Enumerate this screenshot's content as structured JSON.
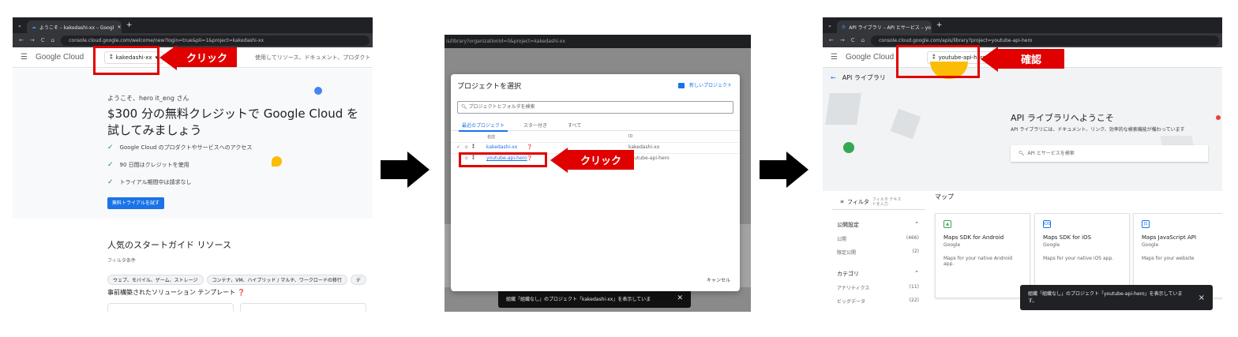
{
  "panel1": {
    "tab_title": "ようこそ – kakedashi-xx – Googl",
    "tab_close": "×",
    "tab_new": "+",
    "url": "console.cloud.google.com/welcome/new?login=true&pli=1&project=kakedashi-xx",
    "nav_icons": [
      "←",
      "→",
      "C",
      "⌂"
    ],
    "logo_google": "Google",
    "logo_cloud": " Cloud",
    "project_name": "kakedashi-xx",
    "search_placeholder": "使用してリソース、ドキュメント、プロダクト",
    "welcome_greeting": "ようこそ、hero it_eng さん",
    "headline": "$300 分の無料クレジットで Google Cloud を試してみましょう",
    "checklist": [
      "Google Cloud のプロダクトやサービスへのアクセス",
      "90 日間はクレジットを使用",
      "トライアル期間中は請求なし"
    ],
    "trial_button": "無料トライアルを試す",
    "resources_title": "人気のスタートガイド リソース",
    "filter_label": "フィルタ条件",
    "filter_chips": [
      "ウェブ、モバイル、ゲーム、ストレージ",
      "コンテナ、VM、ハイブリッド / マルチ、ワークロードの移行",
      "デ"
    ],
    "solutions_title": "事前構築されたソリューション テンプレート",
    "callout": "クリック"
  },
  "panel2": {
    "url": "is/library?organizationId=0&project=kakedashi-xx",
    "dialog_title": "プロジェクトを選択",
    "new_project": "新しいプロジェクト",
    "search_placeholder": "プロジェクトとフォルダを検索",
    "tabs": [
      "最近のプロジェクト",
      "スター付き",
      "すべて"
    ],
    "col_name": "名前",
    "col_id": "ID",
    "rows": [
      {
        "name": "kakedashi-xx",
        "id": "kakedashi-xx",
        "current": "✓"
      },
      {
        "name": "youtube-api-hero",
        "id": "youtube-api-hero",
        "current": ""
      }
    ],
    "cancel": "キャンセル",
    "toast": "組織「組織なし」のプロジェクト「kakedashi-xx」を表示していま",
    "callout": "クリック"
  },
  "panel3": {
    "tab_title": "API ライブラリ – API とサービス – yo",
    "tab_close": "×",
    "tab_new": "+",
    "url": "console.cloud.google.com/apis/library?project=youtube-api-hero",
    "nav_icons": [
      "←",
      "→",
      "C",
      "⌂"
    ],
    "logo_google": "Google",
    "logo_cloud": " Cloud",
    "project_name": "youtube-api-hero",
    "page_title": "API ライブラリ",
    "hero_title": "API ライブラリへようこそ",
    "hero_sub": "API ライブラリには、ドキュメント、リンク、効率的な検索機能が備わっています",
    "search_placeholder": "API とサービスを検索",
    "filter_label": "フィルタ",
    "filter_placeholder": "フィルタ テキストを入力",
    "maps_heading": "マップ",
    "sidebar": [
      {
        "heading": "公開設定",
        "items": [
          {
            "label": "公開",
            "count": "(466)"
          },
          {
            "label": "限定公開",
            "count": "(2)"
          }
        ]
      },
      {
        "heading": "カテゴリ",
        "items": [
          {
            "label": "アナリティクス",
            "count": "(11)"
          },
          {
            "label": "ビッグデータ",
            "count": "(22)"
          }
        ]
      }
    ],
    "cards": [
      {
        "icon": "▲",
        "title": "Maps SDK for Android",
        "vendor": "Google",
        "desc": "Maps for your native Android app."
      },
      {
        "icon": "iOS",
        "title": "Maps SDK for iOS",
        "vendor": "Google",
        "desc": "Maps for your native iOS app."
      },
      {
        "icon": "JS",
        "title": "Maps JavaScript API",
        "vendor": "Google",
        "desc": "Maps for your website"
      }
    ],
    "toast": "組織「組織なし」のプロジェクト「youtube-api-hero」を表示していま す。",
    "toast_close": "×",
    "callout": "確認"
  },
  "colors": {
    "red": "#e00000",
    "blue": "#1a73e8",
    "chrome_dark": "#202124"
  }
}
